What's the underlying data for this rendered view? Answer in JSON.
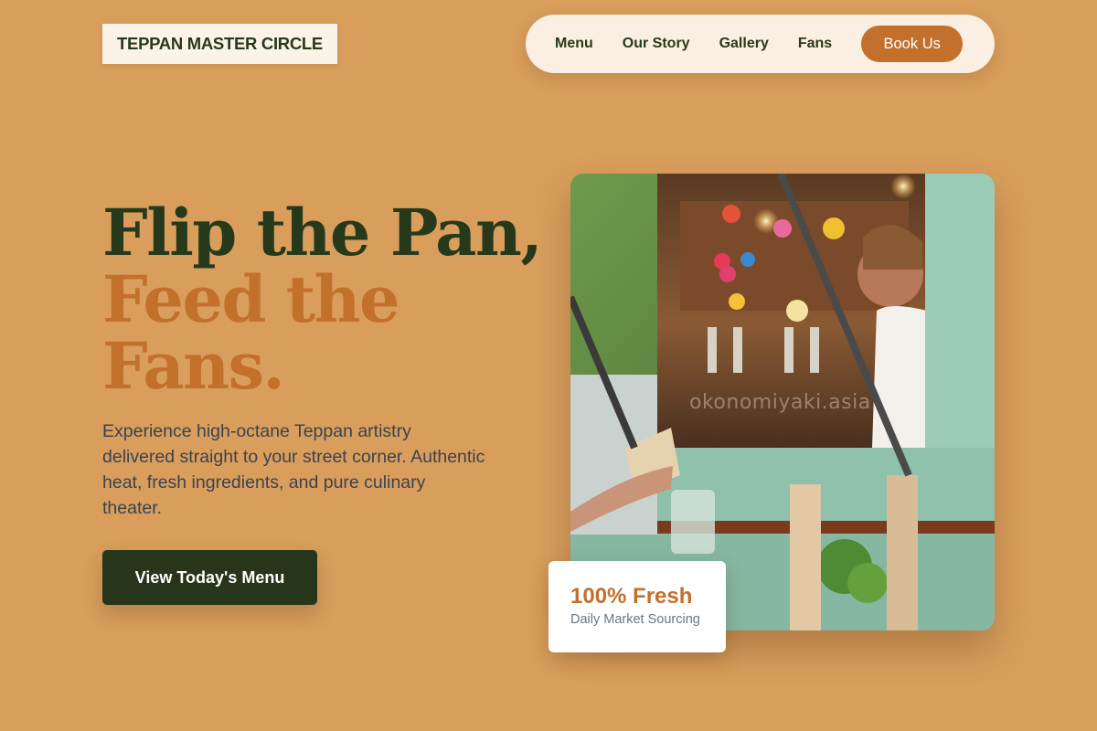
{
  "brand": {
    "name": "TEPPAN MASTER CIRCLE"
  },
  "nav": {
    "links": [
      "Menu",
      "Our Story",
      "Gallery",
      "Fans"
    ],
    "book_label": "Book Us"
  },
  "hero": {
    "headline_line1": "Flip the Pan,",
    "headline_line2": "Feed the",
    "headline_line3": "Fans.",
    "lead": "Experience high-octane Teppan artistry delivered straight to your street corner. Authentic heat, fresh ingredients, and pure culinary theater.",
    "cta_label": "View Today's Menu"
  },
  "photo": {
    "watermark": "okonomiyaki.asia"
  },
  "badge": {
    "title": "100% Fresh",
    "subtitle": "Daily Market Sourcing"
  },
  "colors": {
    "background": "#d99e5c",
    "dark_green": "#27391b",
    "accent_orange": "#c2702c",
    "nav_bg": "#fbefe3"
  }
}
